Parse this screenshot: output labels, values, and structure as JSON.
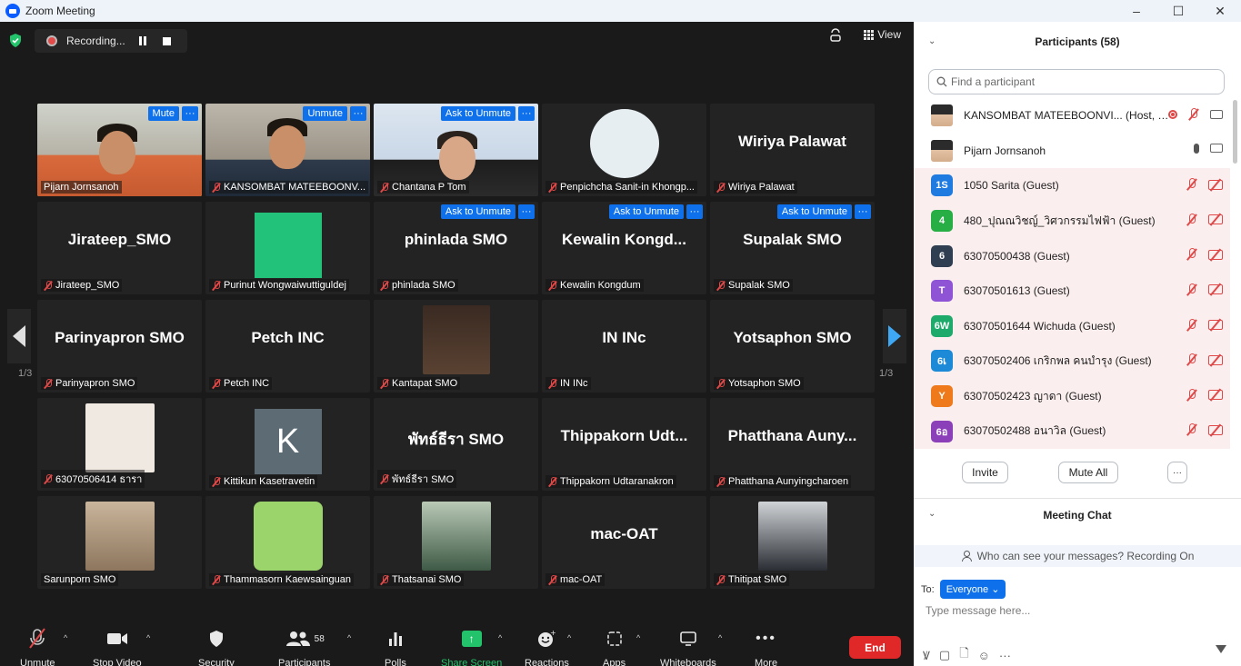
{
  "window": {
    "title": "Zoom Meeting",
    "minimize": "–",
    "maximize": "☐",
    "close": "✕"
  },
  "recording": {
    "label": "Recording..."
  },
  "view": {
    "label": "View"
  },
  "pager": {
    "label": "1/3"
  },
  "tiles": [
    {
      "name": "Pijarn Jornsanoh",
      "big": "",
      "muted": false,
      "buttons": [
        "Mute"
      ],
      "kind": "live1",
      "active": true
    },
    {
      "name": "KANSOMBAT MATEEBOONV...",
      "big": "",
      "muted": true,
      "buttons": [
        "Unmute"
      ],
      "kind": "live2"
    },
    {
      "name": "Chantana P Tom",
      "big": "",
      "muted": true,
      "buttons": [
        "Ask to Unmute"
      ],
      "kind": "live3"
    },
    {
      "name": "Penpichcha Sanit-in Khongp...",
      "big": "",
      "muted": true,
      "buttons": [],
      "kind": "avatar"
    },
    {
      "name": "Wiriya Palawat",
      "big": "Wiriya Palawat",
      "muted": true,
      "buttons": [],
      "kind": "text"
    },
    {
      "name": "Jirateep_SMO",
      "big": "Jirateep_SMO",
      "muted": true,
      "buttons": [],
      "kind": "text"
    },
    {
      "name": "Purinut Wongwaiwuttiguldej",
      "big": "",
      "muted": true,
      "buttons": [],
      "kind": "green"
    },
    {
      "name": "phinlada SMO",
      "big": "phinlada SMO",
      "muted": true,
      "buttons": [
        "Ask to Unmute"
      ],
      "kind": "text"
    },
    {
      "name": "Kewalin Kongdum",
      "big": "Kewalin Kongd...",
      "muted": true,
      "buttons": [
        "Ask to Unmute"
      ],
      "kind": "text"
    },
    {
      "name": "Supalak SMO",
      "big": "Supalak SMO",
      "muted": true,
      "buttons": [
        "Ask to Unmute"
      ],
      "kind": "text"
    },
    {
      "name": "Parinyapron SMO",
      "big": "Parinyapron SMO",
      "muted": true,
      "buttons": [],
      "kind": "text"
    },
    {
      "name": "Petch INC",
      "big": "Petch INC",
      "muted": true,
      "buttons": [],
      "kind": "text"
    },
    {
      "name": "Kantapat SMO",
      "big": "",
      "muted": true,
      "buttons": [],
      "kind": "room"
    },
    {
      "name": "IN INc",
      "big": "IN INc",
      "muted": true,
      "buttons": [],
      "kind": "text"
    },
    {
      "name": "Yotsaphon SMO",
      "big": "Yotsaphon SMO",
      "muted": true,
      "buttons": [],
      "kind": "text"
    },
    {
      "name": "63070506414 ธารา",
      "big": "",
      "muted": true,
      "buttons": [],
      "kind": "avatar2"
    },
    {
      "name": "Kittikun Kasetravetin",
      "big": "",
      "muted": true,
      "buttons": [],
      "kind": "letterK"
    },
    {
      "name": "พัทธ์ธีรา SMO",
      "big": "พัทธ์ธีรา SMO",
      "muted": true,
      "buttons": [],
      "kind": "text"
    },
    {
      "name": "Thippakorn Udtaranakron",
      "big": "Thippakorn Udt...",
      "muted": true,
      "buttons": [],
      "kind": "text"
    },
    {
      "name": "Phatthana Aunyingcharoen",
      "big": "Phatthana Auny...",
      "muted": true,
      "buttons": [],
      "kind": "text"
    },
    {
      "name": "Sarunporn SMO",
      "big": "",
      "muted": false,
      "buttons": [],
      "kind": "photo1"
    },
    {
      "name": "Thammasorn Kaewsainguan",
      "big": "",
      "muted": true,
      "buttons": [],
      "kind": "cartoon"
    },
    {
      "name": "Thatsanai SMO",
      "big": "",
      "muted": true,
      "buttons": [],
      "kind": "photo2"
    },
    {
      "name": "mac-OAT",
      "big": "mac-OAT",
      "muted": true,
      "buttons": [],
      "kind": "text"
    },
    {
      "name": "Thitipat  SMO",
      "big": "",
      "muted": true,
      "buttons": [],
      "kind": "photo3"
    }
  ],
  "toolbar": {
    "unmute": "Unmute",
    "stop_video": "Stop Video",
    "security": "Security",
    "participants": "Participants",
    "participants_count": "58",
    "polls": "Polls",
    "share_screen": "Share Screen",
    "reactions": "Reactions",
    "apps": "Apps",
    "whiteboards": "Whiteboards",
    "more": "More",
    "end": "End"
  },
  "panel": {
    "title": "Participants (58)",
    "search_placeholder": "Find a participant",
    "participants": [
      {
        "name": "KANSOMBAT MATEEBOONVI... (Host, me)",
        "avatar": "",
        "color": "",
        "type": "host"
      },
      {
        "name": "Pijarn Jornsanoh",
        "avatar": "",
        "color": "",
        "type": "speaker"
      },
      {
        "name": "1050 Sarita (Guest)",
        "avatar": "1S",
        "color": "#1f7be0",
        "type": "guest"
      },
      {
        "name": "480_ปุณณวิชญ์_วิศวกรรมไฟฟ้า (Guest)",
        "avatar": "4",
        "color": "#27ae45",
        "type": "guest"
      },
      {
        "name": "63070500438 (Guest)",
        "avatar": "6",
        "color": "#2f3e50",
        "type": "guest"
      },
      {
        "name": "63070501613 (Guest)",
        "avatar": "T",
        "color": "#8f54d6",
        "type": "guest"
      },
      {
        "name": "63070501644 Wichuda (Guest)",
        "avatar": "6W",
        "color": "#1eaa6a",
        "type": "guest"
      },
      {
        "name": "63070502406 เกริกพล คนบำรุง (Guest)",
        "avatar": "6เ",
        "color": "#1c8ad6",
        "type": "guest"
      },
      {
        "name": "63070502423 ญาดา (Guest)",
        "avatar": "Y",
        "color": "#ee7a1c",
        "type": "guest"
      },
      {
        "name": "63070502488 อนาวิล (Guest)",
        "avatar": "6อ",
        "color": "#8b3fb8",
        "type": "guest"
      }
    ],
    "invite": "Invite",
    "mute_all": "Mute All",
    "more": "···",
    "chat_title": "Meeting Chat",
    "chat_info": "Who can see your messages? Recording On",
    "to_label": "To:",
    "to_value": "Everyone",
    "chat_placeholder": "Type message here...",
    "ellipsis": "···"
  }
}
